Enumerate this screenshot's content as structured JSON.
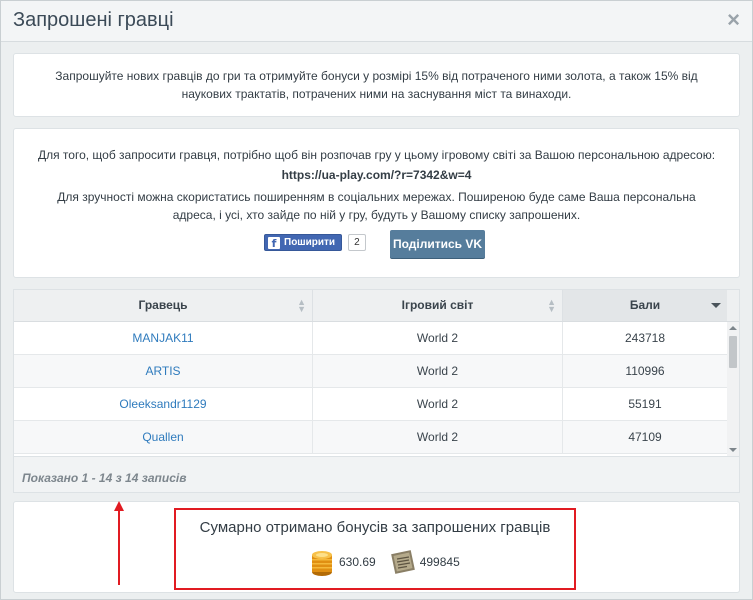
{
  "dialog": {
    "title": "Запрошені гравці",
    "close_symbol": "×"
  },
  "intro": {
    "text": "Запрошуйте нових гравців до гри та отримуйте бонуси у розмірі 15% від потраченого ними золота, а також 15% від наукових трактатів, потрачених ними на заснування міст та винаходи."
  },
  "invite": {
    "line1": "Для того, щоб запросити гравця, потрібно щоб він розпочав гру у цьому ігровому світі за Вашою персональною адресою:",
    "url": "https://ua-play.com/?r=7342&w=4",
    "line3": "Для зручності можна скористатись поширенням в соціальних мережах. Поширеною буде саме Ваша персональна адреса, і усі, хто зайде по ній у гру, будуть у Вашому списку запрошених.",
    "fb_label": "Поширити",
    "fb_count": "2",
    "vk_label": "Поділитись VK"
  },
  "table": {
    "headers": [
      "Гравець",
      "Ігровий світ",
      "Бали"
    ],
    "rows": [
      {
        "player": "MANJAK11",
        "world": "World 2",
        "points": "243718"
      },
      {
        "player": "ARTIS",
        "world": "World 2",
        "points": "110996"
      },
      {
        "player": "Oleeksandr1129",
        "world": "World 2",
        "points": "55191"
      },
      {
        "player": "Quallen",
        "world": "World 2",
        "points": "47109"
      }
    ],
    "info": "Показано 1 - 14 з 14 записів"
  },
  "summary": {
    "title": "Сумарно отримано бонусів за запрошених гравців",
    "gold_value": "630.69",
    "treatise_value": "499845"
  },
  "icons": {
    "close": "close-icon",
    "facebook": "facebook-icon",
    "gold": "gold-coins-icon",
    "treatise": "scroll-icon",
    "arrow": "red-arrow-icon"
  },
  "colors": {
    "link": "#2f7bbd",
    "vk_button": "#567d9c",
    "fb_button": "#4267b2",
    "highlight": "#e11b22"
  }
}
